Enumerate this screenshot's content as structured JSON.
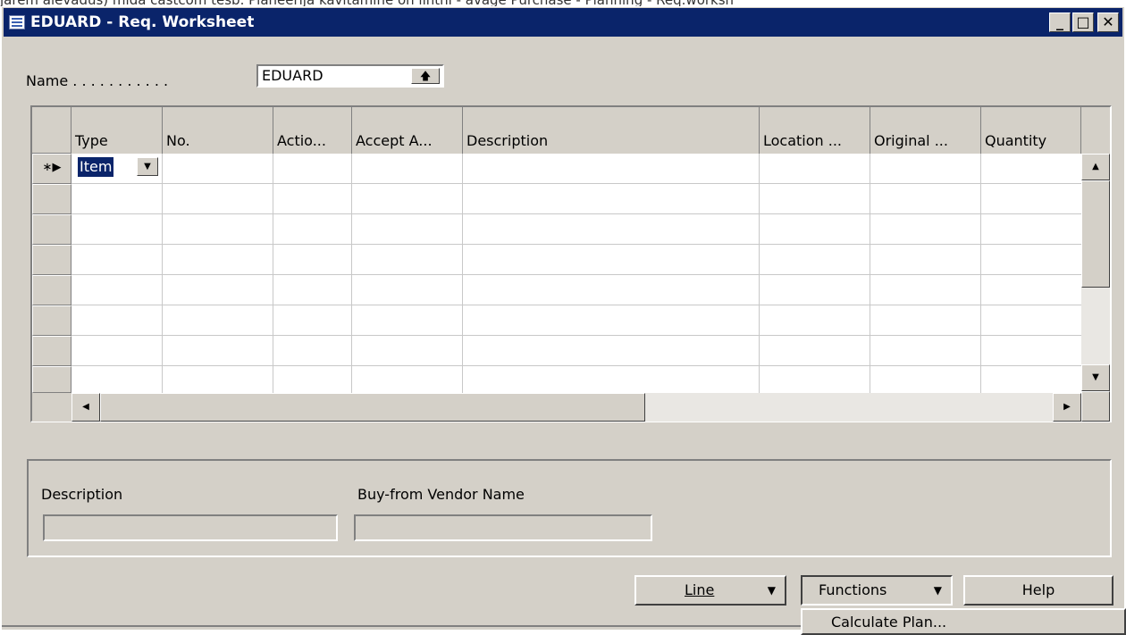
{
  "caption_text": "jarem alevadus) mida castcom tesb. Planeerija kavitamine on linthi - avage Purchase - Planning - Req.worksh",
  "window": {
    "title": "EDUARD - Req. Worksheet",
    "controls": [
      "_",
      "□",
      "✕"
    ]
  },
  "name_field": {
    "label": "Name . . . . . . . . . . .",
    "value": "EDUARD",
    "lookup_icon": "up-arrow-icon"
  },
  "grid": {
    "columns": [
      "Type",
      "No.",
      "Actio...",
      "Accept A...",
      "Description",
      "Location ...",
      "Original ...",
      "Quantity"
    ],
    "new_row_marker": "∗▶",
    "rows": [
      {
        "type": "Item",
        "no": "",
        "action": "",
        "accept": "",
        "description": "",
        "location": "",
        "original": "",
        "quantity": ""
      }
    ]
  },
  "detail_panel": {
    "description_label": "Description",
    "description_value": "",
    "vendor_label": "Buy-from Vendor Name",
    "vendor_value": ""
  },
  "buttons": {
    "line_label": "Line",
    "functions_label": "Functions",
    "help_label": "Help"
  },
  "menu": {
    "calculate_plan_label": "Calculate Plan..."
  }
}
